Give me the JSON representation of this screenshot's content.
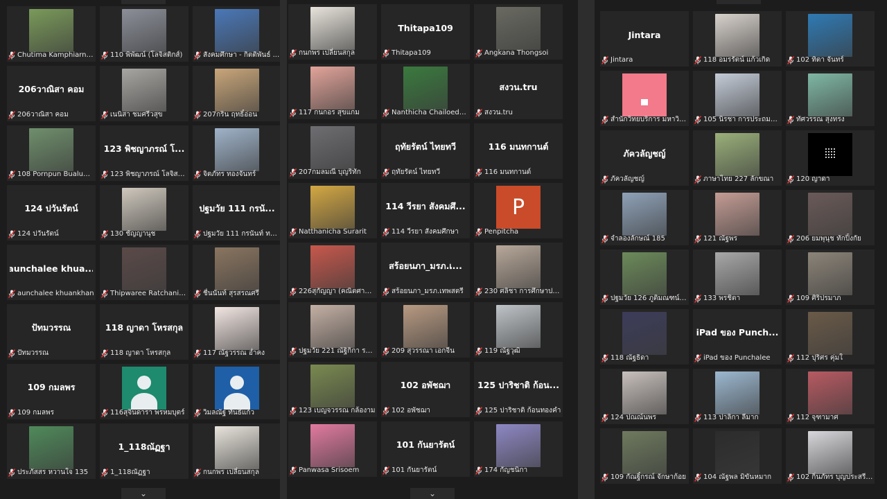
{
  "chevron_down": "⌄",
  "panels": [
    {
      "tiles": [
        {
          "label": "Chutima Kamphiarnon",
          "thumb": "#7a9a5a"
        },
        {
          "label": "110 พิพัฒน์ (โลจิสติกส์)",
          "thumb": "#8c8f99"
        },
        {
          "label": "สังคมศึกษา - กิตติพันธ์ ...",
          "thumb": "#4a78b8"
        },
        {
          "label": "206วาณิสา คอม",
          "big": "206วาณิสา คอม"
        },
        {
          "label": "เนนิสา ชมศรีวสุข",
          "thumb": "#a8a6a2"
        },
        {
          "label": "207กริน ฤทธิ์อ่อน",
          "thumb": "#c9a67a"
        },
        {
          "label": "108 Pornpun Bualuan...",
          "thumb": "#6f8f6c"
        },
        {
          "label": "123 พิชญาภรณ์ โลจิสติ...",
          "big": "123 พิชญาภรณ์ โ..."
        },
        {
          "label": "จิตภัทร ทองจันทร์",
          "thumb": "#9fb3c9"
        },
        {
          "label": "124 ปวันรัตน์",
          "big": "124 ปวันรัตน์"
        },
        {
          "label": "130 ชัญญานุช",
          "thumb": "#cfc8bd"
        },
        {
          "label": "ปฐมวัย 111 กรนันท์ ทอง...",
          "big": "ปฐมวัย 111 กรนั..."
        },
        {
          "label": "aunchalee khuankhan",
          "big": "aunchalee khua..."
        },
        {
          "label": "Thipwaree Ratchanikun",
          "thumb": "#5a4a48"
        },
        {
          "label": "ชื่นนันท์ สุรสรณศรี",
          "thumb": "#8a7560"
        },
        {
          "label": "ปัทมวรรณ",
          "big": "ปัทมวรรณ"
        },
        {
          "label": "118 ญาดา โหรสกุล",
          "big": "118 ญาดา โหรสกุล"
        },
        {
          "label": "117 ณัฐวรรณ อ่ำคง",
          "thumb": "#f2e6e2"
        },
        {
          "label": "109 กมลพร",
          "big": "109 กมลพร"
        },
        {
          "label": "116สุจินดารา พรหมบุตร์",
          "avatar": "green"
        },
        {
          "label": "วิมลณัฐ ทันธิแก้ว",
          "avatar": "blue"
        },
        {
          "label": "ประภัสสร หวานใจ 135",
          "thumb": "#4f8a5a"
        },
        {
          "label": "1_118ณัฏฐา",
          "big": "1_118ณัฏฐา"
        },
        {
          "label": "กนกพร เปลี่ยนสกุล",
          "thumb": "#e8e4dc"
        }
      ]
    },
    {
      "tiles": [
        {
          "label": "กนกพร เปลี่ยนสกุล",
          "thumb": "#e8e4dc"
        },
        {
          "label": "Thitapa109",
          "big": "Thitapa109"
        },
        {
          "label": "Angkana Thongsoi",
          "thumb": "#6a6a62"
        },
        {
          "label": "117 กนกอร สุขแกม",
          "thumb": "#e2a49a"
        },
        {
          "label": "Nanthicha Chailoedo...",
          "thumb": "#3a7a3e"
        },
        {
          "label": "สงวน.tru",
          "big": "สงวน.tru"
        },
        {
          "label": "207กมลมณี บุญริทัก",
          "thumb": "#6e6e72"
        },
        {
          "label": "ฤทัยรัตน์ ไทยทวี",
          "big": "ฤทัยรัตน์ ไทยทวี"
        },
        {
          "label": "116 มนทกานต์",
          "big": "116 มนทกานต์"
        },
        {
          "label": "Natthanicha Surarit",
          "thumb": "#d4a843"
        },
        {
          "label": "114 วีรยา สังคมศึกษา",
          "big": "114 วีรยา สังคมศึ..."
        },
        {
          "label": "Penpitcha",
          "ppt": "P"
        },
        {
          "label": "226สุกัญญา (คณิตศาสตร์)",
          "thumb": "#c8584c"
        },
        {
          "label": "สร้อยนภา_มรภ.เทพสตรี",
          "big": "สร้อยนภา_มรภ.เ..."
        },
        {
          "label": "230 ศลิชา การศึกษาปฐม...",
          "thumb": "#b8a89a"
        },
        {
          "label": "ปฐมวัย 221 ณัฐิกิกา ราช...",
          "thumb": "#c4b0a4"
        },
        {
          "label": "209 สุวรรณา เอกจีน",
          "thumb": "#b89a82"
        },
        {
          "label": "119 ณัฐวุฒิ",
          "thumb": "#bfc4c8"
        },
        {
          "label": "123 เบญจวรรณ กล้องาม",
          "thumb": "#7a8a50"
        },
        {
          "label": "102 อพัชฌา",
          "big": "102 อพัชฌา"
        },
        {
          "label": "125 ปาริชาติ ก้อนทองคำ",
          "big": "125 ปาริชาติ ก้อน..."
        },
        {
          "label": "Panwasa Srisoem",
          "thumb": "#e27aa0"
        },
        {
          "label": "101 กันยารัตน์",
          "big": "101 กันยารัตน์"
        },
        {
          "label": "174 กัญชนิกา",
          "thumb": "#8e88c4"
        }
      ]
    },
    {
      "tiles": [
        {
          "label": "Jintara",
          "big": "Jintara"
        },
        {
          "label": "118 อมรรัตน์ แก้วเกิด",
          "thumb": "#d8d2cc"
        },
        {
          "label": "102 ทิตา จันทร์",
          "thumb": "#2f7ab4"
        },
        {
          "label": "สำนักวิทยบริการ มหาวิท...",
          "library": true
        },
        {
          "label": "105 นิรชา การประถมศึกษา",
          "thumb": "#c4ccd8"
        },
        {
          "label": "ทัศวรรณ สุงทรง",
          "thumb": "#7fb8a4"
        },
        {
          "label": "ภัควลัญชญ์",
          "big": "ภัควลัญชญ์"
        },
        {
          "label": "ภาษาไทย 227 ลักขณา",
          "thumb": "#9ab07a"
        },
        {
          "label": "120 ญาดา",
          "treasure": true
        },
        {
          "label": "จำลองลักษณ์ 185",
          "thumb": "#8fa2b8"
        },
        {
          "label": "121 ณัฐพร",
          "thumb": "#c49c94"
        },
        {
          "label": "206 ยมพุนุช ทักปิ้งกัย",
          "thumb": "#6a5a58"
        },
        {
          "label": "ปฐมวัย 126 ภูติมณฑน์ น่...",
          "thumb": "#6c8a5a"
        },
        {
          "label": "133 พรชิตา",
          "thumb": "#a8a8a8"
        },
        {
          "label": "109 ศิริปรมาภ",
          "thumb": "#8c8478"
        },
        {
          "label": "118 ณัฐธิดา",
          "thumb": "#3c3c5a"
        },
        {
          "label": "iPad ของ Punchalee",
          "big": "iPad ของ Punch..."
        },
        {
          "label": "112 ปุริศร คุ่มใ",
          "thumb": "#6a5a48"
        },
        {
          "label": "124 ปณณ์นพร",
          "thumb": "#c8c0bc"
        },
        {
          "label": "113 ปาลิกา ลีมาก",
          "thumb": "#9cb8d0"
        },
        {
          "label": "112 จุฑามาศ",
          "thumb": "#b85a62"
        },
        {
          "label": "109 กัณฐิ์กรณ์ จักษาก้อย",
          "thumb": "#6e7a5e"
        },
        {
          "label": "104 ณัฐพล มิขันหมาก",
          "thumb": "#2c2c2c"
        },
        {
          "label": "102 กิ่นภัทร บุญประสรีฐ...",
          "thumb": "#d8d8dc"
        }
      ]
    }
  ]
}
